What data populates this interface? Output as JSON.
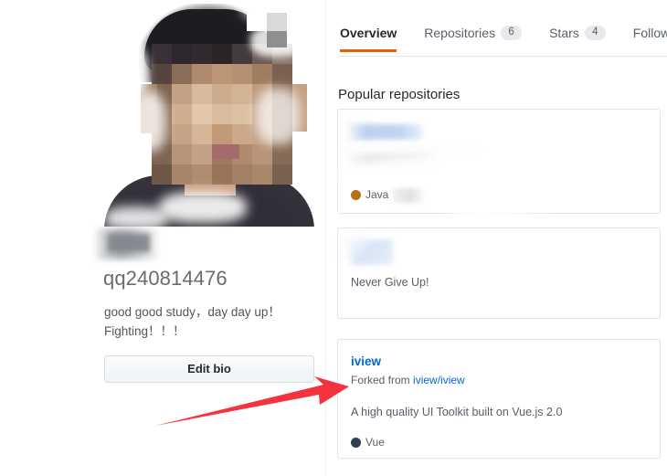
{
  "profile": {
    "avatar_alt": "pixelated-portrait-photo",
    "display_name_redacted": "",
    "login": "qq240814476",
    "bio_line_1": "good good study，day day up！",
    "bio_line_2": "Fighting！！！",
    "edit_bio_label": "Edit bio"
  },
  "tabs": [
    {
      "label": "Overview",
      "count": "",
      "selected": true
    },
    {
      "label": "Repositories",
      "count": "6",
      "selected": false
    },
    {
      "label": "Stars",
      "count": "4",
      "selected": false
    },
    {
      "label": "Follower",
      "count": "",
      "selected": false
    }
  ],
  "main": {
    "section_title": "Popular repositories"
  },
  "repositories": [
    {
      "name": "",
      "name_state": "redacted",
      "description": "",
      "language": "Java",
      "language_color": "#b07219"
    },
    {
      "name": "",
      "name_state": "redacted",
      "description": "Never Give Up!",
      "language": "",
      "language_color": ""
    },
    {
      "name": "iview",
      "name_state": "visible",
      "forked_from_label": "Forked from",
      "forked_from_repo": "iview/iview",
      "description": "A high quality UI Toolkit built on Vue.js 2.0",
      "language": "Vue",
      "language_color": "#2c3e50"
    }
  ],
  "annotation": {
    "type": "arrow",
    "color": "#f5333f",
    "points_to": "iview-repository-card"
  },
  "colors": {
    "tab_active_underline": "#e36209",
    "link": "#0366d6",
    "border": "#e1e4e8",
    "muted_text": "#586069",
    "java_dot": "#b07219",
    "vue_dot": "#2c3e50"
  }
}
